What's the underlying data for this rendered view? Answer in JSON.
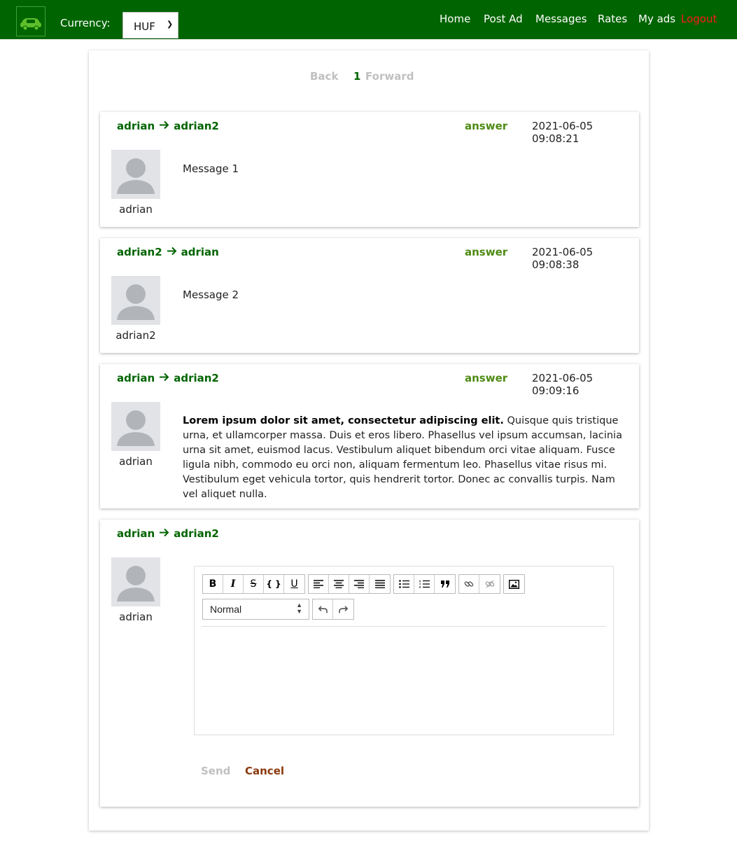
{
  "header": {
    "currency_label": "Currency:",
    "currency_value": "HUF",
    "nav": {
      "home": "Home",
      "post_ad": "Post Ad",
      "messages": "Messages",
      "rates": "Rates",
      "my_ads": "My ads",
      "logout": "Logout"
    }
  },
  "pager": {
    "back": "Back",
    "current_page": "1",
    "forward": "Forward"
  },
  "messages": [
    {
      "from": "adrian",
      "to": "adrian2",
      "answer": "answer",
      "timestamp": "2021-06-05 09:08:21",
      "author": "adrian",
      "body": "Message 1"
    },
    {
      "from": "adrian2",
      "to": "adrian",
      "answer": "answer",
      "timestamp": "2021-06-05 09:08:38",
      "author": "adrian2",
      "body": "Message 2"
    },
    {
      "from": "adrian",
      "to": "adrian2",
      "answer": "answer",
      "timestamp": "2021-06-05 09:09:16",
      "author": "adrian",
      "body_bold": "Lorem ipsum dolor sit amet, consectetur adipiscing elit.",
      "body": "Quisque quis tristique urna, et ullamcorper massa. Duis et eros libero. Phasellus vel ipsum accumsan, lacinia urna sit amet, euismod lacus. Vestibulum aliquet bibendum orci vitae aliquam. Fusce ligula nibh, commodo eu orci non, aliquam fermentum leo. Phasellus vitae risus mi. Vestibulum eget vehicula tortor, quis hendrerit tortor. Donec ac convallis turpis. Nam vel aliquet nulla."
    }
  ],
  "reply": {
    "from": "adrian",
    "to": "adrian2",
    "author": "adrian",
    "block_format": "Normal",
    "toolbar": {
      "bold": "B",
      "italic": "I",
      "strikethrough": "S",
      "code": "{ }",
      "underline": "U"
    },
    "send": "Send",
    "cancel": "Cancel"
  },
  "colors": {
    "topbar": "#006400",
    "accent": "#006400",
    "answer": "#4e8b14",
    "logout": "#ff1a1a",
    "cancel": "#8b3a0f",
    "disabled": "#c0c0c0"
  }
}
